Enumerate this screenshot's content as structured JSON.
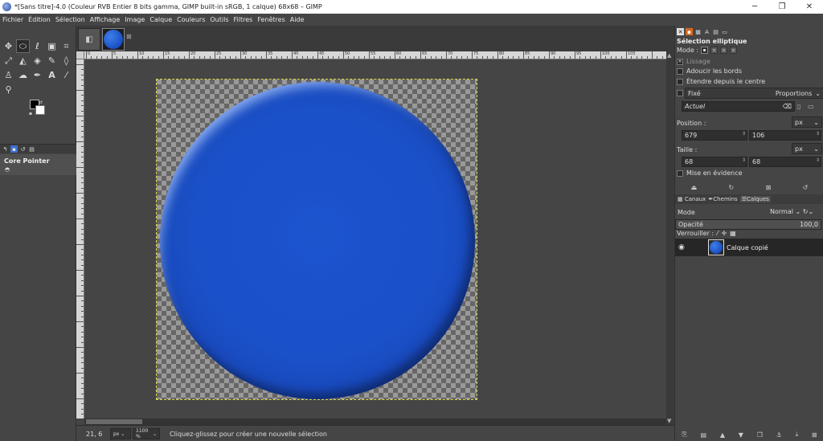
{
  "window": {
    "title": "*[Sans titre]-4.0 (Couleur RVB Entier 8 bits gamma, GIMP built-in sRGB, 1 calque) 68x68 – GIMP",
    "minimize": "─",
    "maximize": "❐",
    "close": "✕"
  },
  "menu": [
    "Fichier",
    "Édition",
    "Sélection",
    "Affichage",
    "Image",
    "Calque",
    "Couleurs",
    "Outils",
    "Filtres",
    "Fenêtres",
    "Aide"
  ],
  "toolbox": {
    "tools": [
      {
        "icon": "move-icon",
        "glyph": "✥"
      },
      {
        "icon": "ellipse-select-icon",
        "glyph": "⬭"
      },
      {
        "icon": "free-select-icon",
        "glyph": "ℓ"
      },
      {
        "icon": "foreground-select-icon",
        "glyph": "▣"
      },
      {
        "icon": "crop-icon",
        "glyph": "⌗"
      },
      {
        "icon": "unified-transform-icon",
        "glyph": "⤢"
      },
      {
        "icon": "warp-transform-icon",
        "glyph": "◭"
      },
      {
        "icon": "bucket-fill-icon",
        "glyph": "◈"
      },
      {
        "icon": "paintbrush-icon",
        "glyph": "✎"
      },
      {
        "icon": "eraser-icon",
        "glyph": "◊"
      },
      {
        "icon": "clone-icon",
        "glyph": "♙"
      },
      {
        "icon": "smudge-icon",
        "glyph": "☁"
      },
      {
        "icon": "path-icon",
        "glyph": "✒"
      },
      {
        "icon": "text-icon",
        "glyph": "A"
      },
      {
        "icon": "color-picker-icon",
        "glyph": "⁄"
      },
      {
        "icon": "zoom-icon",
        "glyph": "⚲"
      }
    ],
    "dock_title": "Core Pointer"
  },
  "ruler_labels": [
    "0",
    "5",
    "10",
    "15",
    "20",
    "25",
    "30",
    "35",
    "40",
    "45",
    "50",
    "55",
    "60",
    "65",
    "70",
    "75",
    "80",
    "85",
    "90",
    "95",
    "100",
    "105"
  ],
  "canvas": {
    "coords": "21, 6",
    "unit": "px",
    "zoom": "1100 %",
    "status": "Cliquez-glissez pour créer une nouvelle sélection"
  },
  "tool_options": {
    "title": "Sélection elliptique",
    "mode_label": "Mode :",
    "antialias": "Lissage",
    "feather": "Adoucir les bords",
    "expand_center": "Étendre depuis le centre",
    "fixed": "Fixé",
    "proportions": "Proportions",
    "current": "Actuel",
    "position_label": "Position :",
    "position_unit": "px",
    "pos_x": "679",
    "pos_y": "106",
    "size_label": "Taille :",
    "size_unit": "px",
    "width": "68",
    "height": "68",
    "highlight": "Mise en évidence"
  },
  "layers": {
    "tabs": [
      "Canaux",
      "Chemins",
      "Calques"
    ],
    "mode_label": "Mode",
    "mode_value": "Normal",
    "opacity_label": "Opacité",
    "opacity_value": "100,0",
    "lock_label": "Verrouiller :",
    "layer_name": "Calque copié"
  }
}
